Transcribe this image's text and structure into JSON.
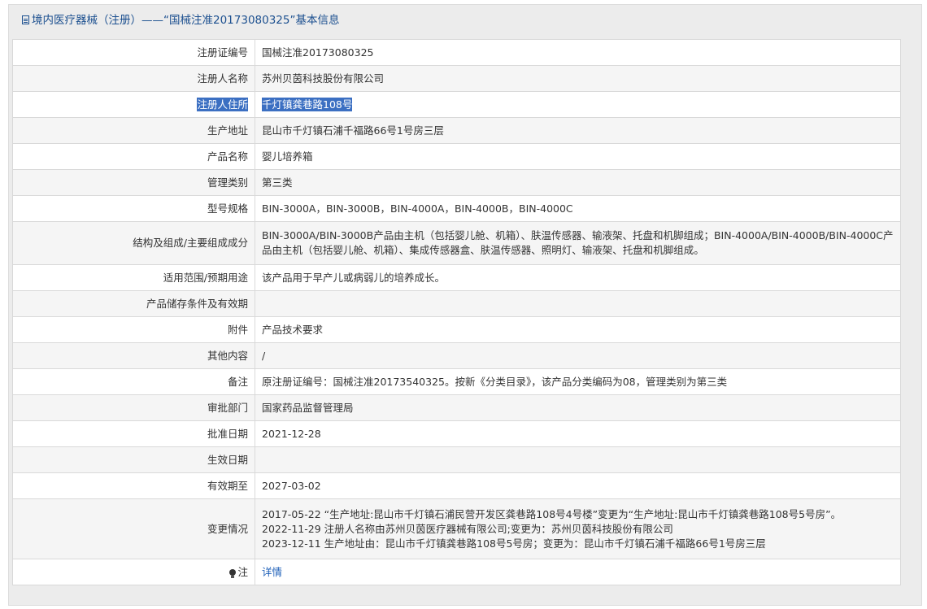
{
  "header": {
    "title": "境内医疗器械（注册）——“国械注准20173080325”基本信息"
  },
  "rows": [
    {
      "label": "注册证编号",
      "value": "国械注准20173080325"
    },
    {
      "label": "注册人名称",
      "value": "苏州贝茵科技股份有限公司"
    },
    {
      "label": "注册人住所",
      "value": "千灯镇龚巷路108号"
    },
    {
      "label": "生产地址",
      "value": "昆山市千灯镇石浦千福路66号1号房三层"
    },
    {
      "label": "产品名称",
      "value": "婴儿培养箱"
    },
    {
      "label": "管理类别",
      "value": "第三类"
    },
    {
      "label": "型号规格",
      "value": "BIN-3000A，BIN-3000B，BIN-4000A，BIN-4000B，BIN-4000C"
    },
    {
      "label": "结构及组成/主要组成成分",
      "value": "BIN-3000A/BIN-3000B产品由主机（包括婴儿舱、机箱）、肤温传感器、输液架、托盘和机脚组成；BIN-4000A/BIN-4000B/BIN-4000C产品由主机（包括婴儿舱、机箱）、集成传感器盒、肤温传感器、照明灯、输液架、托盘和机脚组成。"
    },
    {
      "label": "适用范围/预期用途",
      "value": "该产品用于早产儿或病弱儿的培养成长。"
    },
    {
      "label": "产品储存条件及有效期",
      "value": ""
    },
    {
      "label": "附件",
      "value": "产品技术要求"
    },
    {
      "label": "其他内容",
      "value": "/"
    },
    {
      "label": "备注",
      "value": "原注册证编号：国械注准20173540325。按新《分类目录》，该产品分类编码为08，管理类别为第三类"
    },
    {
      "label": "审批部门",
      "value": "国家药品监督管理局"
    },
    {
      "label": "批准日期",
      "value": "2021-12-28"
    },
    {
      "label": "生效日期",
      "value": ""
    },
    {
      "label": "有效期至",
      "value": "2027-03-02"
    }
  ],
  "changes": {
    "label": "变更情况",
    "lines": [
      "2017-05-22 “生产地址:昆山市千灯镇石浦民营开发区龚巷路108号4号楼”变更为“生产地址:昆山市千灯镇龚巷路108号5号房”。",
      "2022-11-29 注册人名称由苏州贝茵医疗器械有限公司;变更为：苏州贝茵科技股份有限公司",
      "2023-12-11 生产地址由：昆山市千灯镇龚巷路108号5号房；变更为：昆山市千灯镇石浦千福路66号1号房三层"
    ]
  },
  "note": {
    "label": "注",
    "icon": "bulb-icon",
    "link": "详情"
  },
  "colors": {
    "accent": "#1b4f8f",
    "highlight": "#3b6fc2",
    "link": "#1d5fb8"
  }
}
